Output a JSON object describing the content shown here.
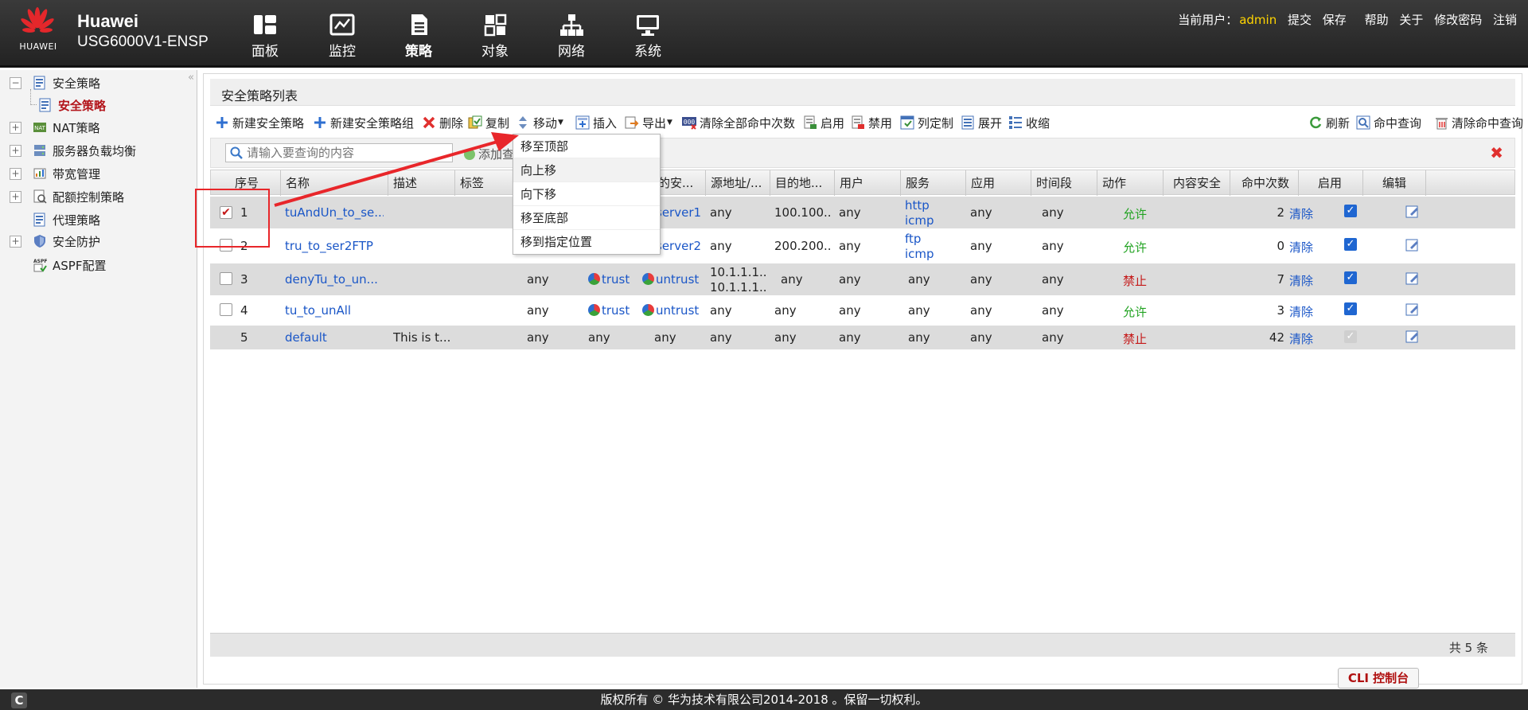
{
  "header": {
    "logo_text": "HUAWEI",
    "brand_name": "Huawei",
    "device_model": "USG6000V1-ENSP",
    "nav": [
      {
        "label": "面板",
        "icon": "dashboard-icon"
      },
      {
        "label": "监控",
        "icon": "monitor-icon"
      },
      {
        "label": "策略",
        "icon": "policy-icon"
      },
      {
        "label": "对象",
        "icon": "object-icon"
      },
      {
        "label": "网络",
        "icon": "network-icon"
      },
      {
        "label": "系统",
        "icon": "system-icon"
      }
    ],
    "current_user_label": "当前用户：",
    "current_user": "admin",
    "links": {
      "submit": "提交",
      "save": "保存",
      "help": "帮助",
      "about": "关于",
      "change_password": "修改密码",
      "logout": "注销"
    }
  },
  "sidebar": {
    "collapse_glyph": "«",
    "items": [
      {
        "label": "安全策略",
        "expander": "−",
        "icon": "policy-icon"
      },
      {
        "label": "安全策略",
        "selected": true,
        "icon": "policy-icon"
      },
      {
        "label": "NAT策略",
        "expander": "+",
        "icon": "nat-icon"
      },
      {
        "label": "服务器负载均衡",
        "expander": "+",
        "icon": "server-icon"
      },
      {
        "label": "带宽管理",
        "expander": "+",
        "icon": "bandwidth-icon"
      },
      {
        "label": "配额控制策略",
        "expander": "+",
        "icon": "quota-icon"
      },
      {
        "label": "代理策略",
        "icon": "proxy-icon"
      },
      {
        "label": "安全防护",
        "expander": "+",
        "icon": "shield-icon"
      },
      {
        "label": "ASPF配置",
        "icon": "aspf-icon"
      }
    ]
  },
  "panel": {
    "title": "安全策略列表",
    "toolbar": {
      "new_policy": "新建安全策略",
      "new_group": "新建安全策略组",
      "delete": "删除",
      "copy": "复制",
      "move": "移动",
      "insert": "插入",
      "export": "导出",
      "clear_hits": "清除全部命中次数",
      "enable": "启用",
      "disable": "禁用",
      "customize_columns": "列定制",
      "expand": "展开",
      "collapse": "收缩",
      "refresh": "刷新",
      "hit_query": "命中查询",
      "clear_hit_query": "清除命中查询"
    },
    "search": {
      "placeholder": "请输入要查询的内容",
      "add_query": "添加查"
    },
    "move_menu": [
      "移至顶部",
      "向上移",
      "向下移",
      "移至底部",
      "移到指定位置"
    ],
    "columns": [
      "序号",
      "名称",
      "描述",
      "标签",
      "",
      "",
      "目的安...",
      "源地址/...",
      "目的地...",
      "用户",
      "服务",
      "应用",
      "时间段",
      "动作",
      "内容安全",
      "命中次数",
      "启用",
      "编辑"
    ],
    "rows": [
      {
        "no": "1",
        "name": "tuAndUn_to_se...",
        "desc": "",
        "src_zone": "",
        "src_zone_name": "",
        "dst_zone": "server1",
        "src_addr": [
          "any"
        ],
        "dst_addr": "100.100....",
        "user": "any",
        "service": [
          "http",
          "icmp"
        ],
        "app": "any",
        "time": "any",
        "action": "允许",
        "hits": "2",
        "clear": "清除",
        "checked": true,
        "enabled": true
      },
      {
        "no": "2",
        "name": "tru_to_ser2FTP",
        "desc": "",
        "src_zone": "",
        "dst_zone": "server2",
        "src_addr": [
          "any"
        ],
        "dst_addr": "200.200....",
        "user": "any",
        "service": [
          "ftp",
          "icmp"
        ],
        "app": "any",
        "time": "any",
        "action": "允许",
        "hits": "0",
        "clear": "清除",
        "checked": false,
        "enabled": true
      },
      {
        "no": "3",
        "name": "denyTu_to_un...",
        "desc": "",
        "src_zone_col": "any",
        "src_zone": "trust",
        "dst_zone": "untrust",
        "src_addr": [
          "10.1.1.1...",
          "10.1.1.1..."
        ],
        "dst_addr": "any",
        "user": "any",
        "service": [
          "any"
        ],
        "app": "any",
        "time": "any",
        "action": "禁止",
        "hits": "7",
        "clear": "清除",
        "checked": false,
        "enabled": true
      },
      {
        "no": "4",
        "name": "tu_to_unAll",
        "desc": "",
        "src_zone_col": "any",
        "src_zone": "trust",
        "dst_zone": "untrust",
        "src_addr": [
          "any"
        ],
        "dst_addr": "any",
        "user": "any",
        "service": [
          "any"
        ],
        "app": "any",
        "time": "any",
        "action": "允许",
        "hits": "3",
        "clear": "清除",
        "checked": false,
        "enabled": true
      },
      {
        "no": "5",
        "name": "default",
        "desc": "This is t...",
        "src_zone_col": "any",
        "src_zone": "any",
        "dst_zone": "any",
        "src_addr": [
          "any"
        ],
        "dst_addr": "any",
        "user": "any",
        "service": [
          "any"
        ],
        "app": "any",
        "time": "any",
        "action": "禁止",
        "hits": "42",
        "clear": "清除",
        "checked": false,
        "enabled": true
      }
    ],
    "total": "共 5 条"
  },
  "footer": {
    "cli_button": "CLI 控制台",
    "copyright": "版权所有 © 华为技术有限公司2014-2018 。保留一切权利。",
    "corner_glyph": "C"
  },
  "colors": {
    "allow": "#22a322",
    "deny": "#c41818",
    "link": "#1a56c7",
    "user": "#ffd400",
    "annotation": "#e8262a"
  }
}
